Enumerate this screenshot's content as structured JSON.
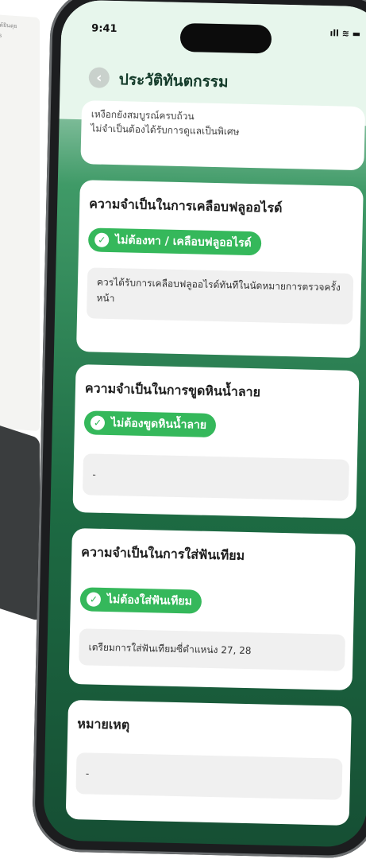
{
  "background": {
    "paper_text_1": "ได้ยินดุย",
    "paper_text_2": "ts"
  },
  "status_bar": {
    "time": "9:41",
    "icons": "ıll ≋ ▬"
  },
  "header": {
    "back_icon": "‹",
    "title": "ประวัติทันตกรรม"
  },
  "partial_card": {
    "line1": "เหงือกยังสมบูรณ์ครบถ้วน",
    "line2": "ไม่จำเป็นต้องได้รับการดูแลเป็นพิเศษ"
  },
  "cards": [
    {
      "title": "ความจำเป็นในการเคลือบฟลูออไรด์",
      "badge": "ไม่ต้องทา / เคลือบฟลูออไรด์",
      "note": "ควรได้รับการเคลือบฟลูออไรด์ทันทีในนัดหมายการตรวจครั้งหน้า"
    },
    {
      "title": "ความจำเป็นในการขูดหินน้ำลาย",
      "badge": "ไม่ต้องขูดหินน้ำลาย",
      "note": "-"
    },
    {
      "title": "ความจำเป็นในการใส่ฟันเทียม",
      "badge": "ไม่ต้องใส่ฟันเทียม",
      "note": "เตรียมการใส่ฟันเทียมซี่ตำแหน่ง 27, 28"
    },
    {
      "title": "หมายเหตุ",
      "note": "-"
    }
  ],
  "colors": {
    "accent": "#35b85b",
    "dark_green": "#1d6b43"
  }
}
